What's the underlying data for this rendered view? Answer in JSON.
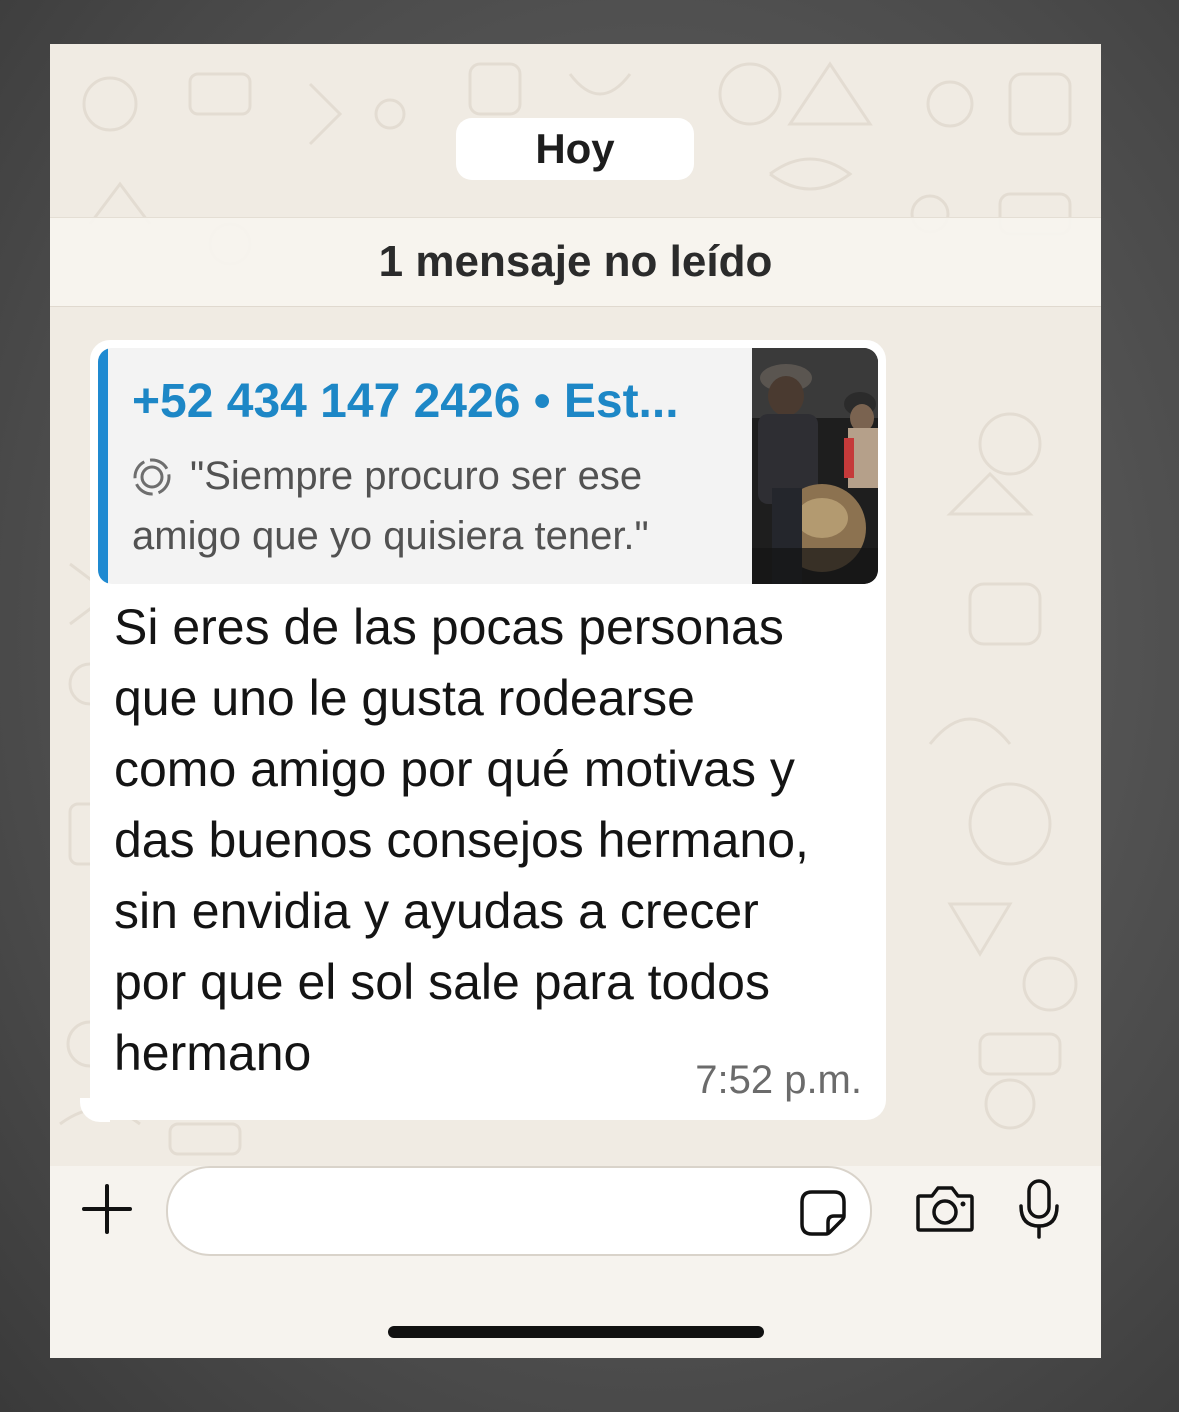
{
  "chat": {
    "date_chip": "Hoy",
    "unread_banner": "1 mensaje no leído"
  },
  "message": {
    "quote": {
      "author": "+52 434 147 2426 • Est...",
      "line1": "\"Siempre procuro ser ese",
      "line2": "amigo que yo quisiera tener.\"",
      "status_icon": "status-ring-icon"
    },
    "text": "Si eres de las pocas personas\nque uno le gusta rodearse\ncomo amigo por qué motivas y\ndas buenos consejos hermano,\nsin envidia y ayudas a crecer\npor que el sol sale para todos\nhermano",
    "time": "7:52 p.m."
  },
  "input_bar": {
    "icons": [
      "plus-icon",
      "sticker-icon",
      "camera-icon",
      "microphone-icon"
    ]
  },
  "colors": {
    "accent": "#1d87c6",
    "quote_bar": "#1f8ad1",
    "chat_background": "#f0ebe3",
    "bubble": "#ffffff"
  }
}
